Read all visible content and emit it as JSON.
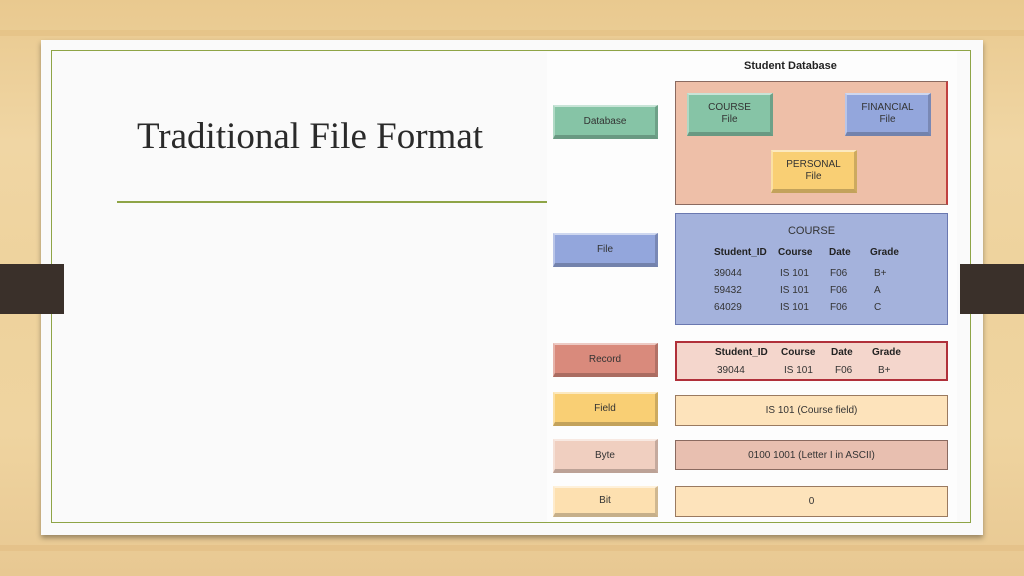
{
  "slide": {
    "title": "Traditional File Format"
  },
  "figure": {
    "title": "Student Database",
    "colors": {
      "database": "#86c4a6",
      "file": "#93a6dc",
      "record": "#d98a7c",
      "field": "#f9cf74",
      "byte": "#f0cfc0",
      "bit": "#fde0b0",
      "db_panel": "#eebfa8",
      "file_panel": "#a4b2dc",
      "record_panel": "#f4d6cc",
      "field_panel": "#fde3bb",
      "byte_panel": "#e8bfb0",
      "bit_panel": "#fde3bb"
    },
    "levels": [
      {
        "label": "Database"
      },
      {
        "label": "File"
      },
      {
        "label": "Record"
      },
      {
        "label": "Field"
      },
      {
        "label": "Byte"
      },
      {
        "label": "Bit"
      }
    ],
    "database_panel": {
      "files": [
        {
          "line1": "COURSE",
          "line2": "File"
        },
        {
          "line1": "FINANCIAL",
          "line2": "File"
        },
        {
          "line1": "PERSONAL",
          "line2": "File"
        }
      ]
    },
    "file_panel": {
      "name": "COURSE",
      "headers": [
        "Student_ID",
        "Course",
        "Date",
        "Grade"
      ],
      "rows": [
        [
          "39044",
          "IS 101",
          "F06",
          "B+"
        ],
        [
          "59432",
          "IS 101",
          "F06",
          "A"
        ],
        [
          "64029",
          "IS 101",
          "F06",
          "C"
        ]
      ]
    },
    "record_panel": {
      "headers": [
        "Student_ID",
        "Course",
        "Date",
        "Grade"
      ],
      "row": [
        "39044",
        "IS 101",
        "F06",
        "B+"
      ]
    },
    "field_panel": {
      "text": "IS 101   (Course field)"
    },
    "byte_panel": {
      "text": "0100 1001  (Letter I in ASCII)"
    },
    "bit_panel": {
      "text": "0"
    }
  }
}
